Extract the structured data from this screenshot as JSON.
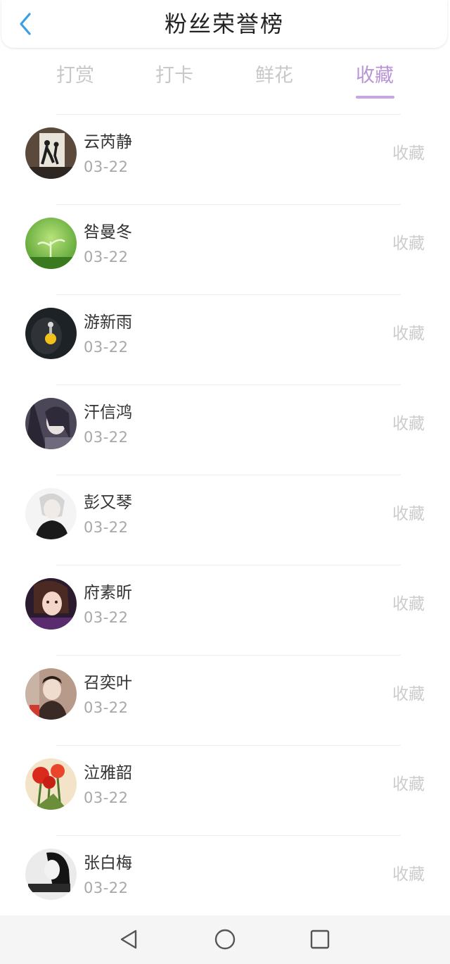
{
  "header": {
    "title": "粉丝荣誉榜",
    "back_icon": "chevron-left-icon",
    "accent": "#3b9ee0"
  },
  "tabs": [
    {
      "label": "打赏",
      "active": false
    },
    {
      "label": "打卡",
      "active": false
    },
    {
      "label": "鲜花",
      "active": false
    },
    {
      "label": "收藏",
      "active": true
    }
  ],
  "active_color": "#b995d8",
  "fans": [
    {
      "name": "云芮静",
      "date": "03-22",
      "action": "收藏"
    },
    {
      "name": "咎曼冬",
      "date": "03-22",
      "action": "收藏"
    },
    {
      "name": "游新雨",
      "date": "03-22",
      "action": "收藏"
    },
    {
      "name": "汗信鸿",
      "date": "03-22",
      "action": "收藏"
    },
    {
      "name": "彭又琴",
      "date": "03-22",
      "action": "收藏"
    },
    {
      "name": "府素昕",
      "date": "03-22",
      "action": "收藏"
    },
    {
      "name": "召奕叶",
      "date": "03-22",
      "action": "收藏"
    },
    {
      "name": "泣雅韶",
      "date": "03-22",
      "action": "收藏"
    },
    {
      "name": "张白梅",
      "date": "03-22",
      "action": "收藏"
    }
  ],
  "navbar": {
    "back": "triangle-back-icon",
    "home": "circle-home-icon",
    "recent": "square-recent-icon"
  }
}
